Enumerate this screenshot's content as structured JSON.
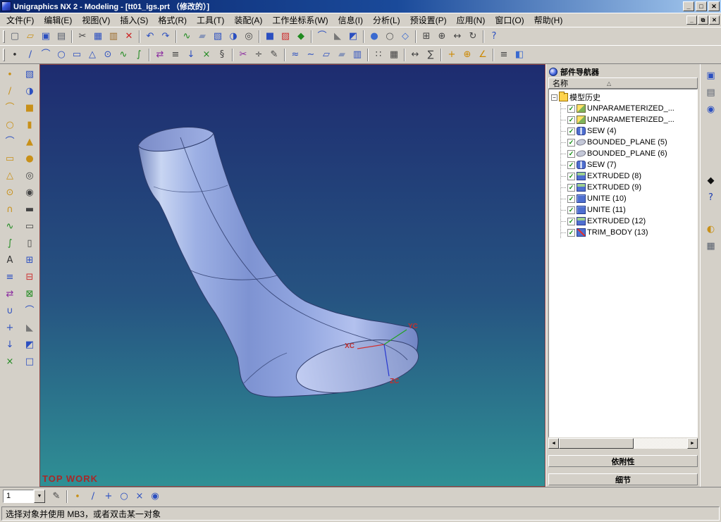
{
  "window": {
    "title": "Unigraphics NX 2 - Modeling - [tt01_igs.prt （修改的）]",
    "controls": {
      "minimize": "_",
      "maximize": "□",
      "close": "✕"
    }
  },
  "menu": {
    "items": [
      {
        "key": "file",
        "label": "文件(F)"
      },
      {
        "key": "edit",
        "label": "编辑(E)"
      },
      {
        "key": "view",
        "label": "视图(V)"
      },
      {
        "key": "insert",
        "label": "插入(S)"
      },
      {
        "key": "format",
        "label": "格式(R)"
      },
      {
        "key": "tools",
        "label": "工具(T)"
      },
      {
        "key": "assemblies",
        "label": "装配(A)"
      },
      {
        "key": "wcs",
        "label": "工作坐标系(W)"
      },
      {
        "key": "information",
        "label": "信息(I)"
      },
      {
        "key": "analysis",
        "label": "分析(L)"
      },
      {
        "key": "preferences",
        "label": "预设置(P)"
      },
      {
        "key": "application",
        "label": "应用(N)"
      },
      {
        "key": "window",
        "label": "窗口(O)"
      },
      {
        "key": "help",
        "label": "帮助(H)"
      }
    ],
    "child_controls": {
      "minimize": "_",
      "restore": "⧉",
      "close": "✕"
    }
  },
  "toolbar_main": {
    "items": [
      {
        "n": "new",
        "g": "▢",
        "c": "#58606e"
      },
      {
        "n": "open",
        "g": "▱",
        "c": "#c89018"
      },
      {
        "n": "save",
        "g": "▣",
        "c": "#2b4fc0"
      },
      {
        "n": "print",
        "g": "▤",
        "c": "#58606e"
      },
      {
        "sep": true
      },
      {
        "n": "cut",
        "g": "✂",
        "c": "#444444"
      },
      {
        "n": "copy",
        "g": "▦",
        "c": "#2b4fc0"
      },
      {
        "n": "paste",
        "g": "▥",
        "c": "#9a6a2a"
      },
      {
        "n": "delete",
        "g": "✕",
        "c": "#cc2020"
      },
      {
        "sep": true
      },
      {
        "n": "undo",
        "g": "↶",
        "c": "#2b4fc0"
      },
      {
        "n": "redo",
        "g": "↷",
        "c": "#2b4fc0"
      },
      {
        "sep": true
      },
      {
        "n": "sketch",
        "g": "∿",
        "c": "#1f8a1f"
      },
      {
        "n": "datum-plane",
        "g": "▰",
        "c": "#8a97b8"
      },
      {
        "n": "extrude",
        "g": "▧",
        "c": "#2b4fc0"
      },
      {
        "n": "revolve",
        "g": "◑",
        "c": "#2b4fc0"
      },
      {
        "n": "hole",
        "g": "◎",
        "c": "#444444"
      },
      {
        "sep": true
      },
      {
        "n": "unite",
        "g": "■",
        "c": "#2b4fc0"
      },
      {
        "n": "subtract",
        "g": "▨",
        "c": "#cc3030"
      },
      {
        "n": "intersect",
        "g": "◆",
        "c": "#1f8a1f"
      },
      {
        "sep": true
      },
      {
        "n": "edge-blend",
        "g": "⌒",
        "c": "#2b4fc0"
      },
      {
        "n": "chamfer",
        "g": "◣",
        "c": "#777777"
      },
      {
        "n": "trim-body",
        "g": "◩",
        "c": "#2b4fc0"
      },
      {
        "sep": true
      },
      {
        "n": "shaded-view",
        "g": "●",
        "c": "#3a6ad0"
      },
      {
        "n": "wireframe-view",
        "g": "○",
        "c": "#555555"
      },
      {
        "n": "isometric-view",
        "g": "◇",
        "c": "#3a6ad0"
      },
      {
        "sep": true
      },
      {
        "n": "fit-view",
        "g": "⊞",
        "c": "#444444"
      },
      {
        "n": "zoom-view",
        "g": "⊕",
        "c": "#444444"
      },
      {
        "n": "pan-view",
        "g": "↔",
        "c": "#444444"
      },
      {
        "n": "rotate-view",
        "g": "↻",
        "c": "#444444"
      },
      {
        "sep": true
      },
      {
        "n": "help",
        "g": "?",
        "c": "#2b4fc0"
      }
    ]
  },
  "toolbar_curve": {
    "items": [
      {
        "n": "point",
        "g": "∙",
        "c": "#333333"
      },
      {
        "n": "line",
        "g": "∕",
        "c": "#2b4fc0"
      },
      {
        "n": "arc",
        "g": "⌒",
        "c": "#2b4fc0"
      },
      {
        "n": "circle",
        "g": "○",
        "c": "#2b4fc0"
      },
      {
        "n": "rectangle",
        "g": "▭",
        "c": "#2b4fc0"
      },
      {
        "n": "polygon",
        "g": "△",
        "c": "#2b4fc0"
      },
      {
        "n": "ellipse",
        "g": "⊙",
        "c": "#2b4fc0"
      },
      {
        "n": "spline",
        "g": "∿",
        "c": "#1f8a1f"
      },
      {
        "n": "helix",
        "g": "∫",
        "c": "#1f8a1f"
      },
      {
        "sep": true
      },
      {
        "n": "mirror-curve",
        "g": "⇄",
        "c": "#8a2aa0"
      },
      {
        "n": "offset-curve",
        "g": "≡",
        "c": "#444444"
      },
      {
        "n": "project-curve",
        "g": "↓",
        "c": "#2b4fc0"
      },
      {
        "n": "intersection-curve",
        "g": "×",
        "c": "#1f8a1f"
      },
      {
        "n": "section-curve",
        "g": "§",
        "c": "#444444"
      },
      {
        "sep": true
      },
      {
        "n": "trim-curve",
        "g": "✂",
        "c": "#8a2aa0"
      },
      {
        "n": "divide-curve",
        "g": "÷",
        "c": "#444444"
      },
      {
        "n": "edit-curve",
        "g": "✎",
        "c": "#444444"
      },
      {
        "sep": true
      },
      {
        "n": "through-curves",
        "g": "≈",
        "c": "#2b4fc0"
      },
      {
        "n": "swept",
        "g": "∼",
        "c": "#2b4fc0"
      },
      {
        "n": "ruled-surface",
        "g": "▱",
        "c": "#2b4fc0"
      },
      {
        "n": "bounded-plane",
        "g": "▰",
        "c": "#8a97b8"
      },
      {
        "n": "sew-surface",
        "g": "▥",
        "c": "#2b4fc0"
      },
      {
        "sep": true
      },
      {
        "n": "instance-array",
        "g": "∷",
        "c": "#444444"
      },
      {
        "n": "pattern",
        "g": "▦",
        "c": "#444444"
      },
      {
        "sep": true
      },
      {
        "n": "measure-distance",
        "g": "↔",
        "c": "#444444"
      },
      {
        "n": "simple-analysis",
        "g": "∑",
        "c": "#444444"
      },
      {
        "sep": true
      },
      {
        "n": "wcs-dynamics",
        "g": "+",
        "c": "#cc8800"
      },
      {
        "n": "wcs-origin",
        "g": "⊕",
        "c": "#cc8800"
      },
      {
        "n": "wcs-rotate",
        "g": "∠",
        "c": "#cc8800"
      },
      {
        "sep": true
      },
      {
        "n": "layer-settings",
        "g": "≡",
        "c": "#444444"
      },
      {
        "n": "visualization",
        "g": "◧",
        "c": "#3a6ad0"
      }
    ]
  },
  "left_toolbar_1": {
    "items": [
      {
        "n": "curve-point",
        "g": "∙",
        "c": "#c89018"
      },
      {
        "n": "curve-line",
        "g": "∕",
        "c": "#c89018"
      },
      {
        "n": "curve-arc",
        "g": "⌒",
        "c": "#c89018"
      },
      {
        "n": "curve-circle",
        "g": "○",
        "c": "#c89018"
      },
      {
        "n": "curve-fillet",
        "g": "⌒",
        "c": "#2b4fc0"
      },
      {
        "n": "curve-rectangle",
        "g": "▭",
        "c": "#c89018"
      },
      {
        "n": "curve-polygon",
        "g": "△",
        "c": "#c89018"
      },
      {
        "n": "curve-ellipse",
        "g": "⊙",
        "c": "#c89018"
      },
      {
        "n": "curve-conic",
        "g": "∩",
        "c": "#c89018"
      },
      {
        "n": "curve-spline",
        "g": "∿",
        "c": "#1f8a1f"
      },
      {
        "n": "curve-helix",
        "g": "∫",
        "c": "#1f8a1f"
      },
      {
        "n": "curve-text",
        "g": "A",
        "c": "#333333"
      },
      {
        "n": "offset-curve-tool",
        "g": "≡",
        "c": "#2b4fc0"
      },
      {
        "n": "mirror-curve-tool",
        "g": "⇄",
        "c": "#8a2aa0"
      },
      {
        "n": "bridge-curve",
        "g": "∪",
        "c": "#2b4fc0"
      },
      {
        "n": "join-curve",
        "g": "+",
        "c": "#2b4fc0"
      },
      {
        "n": "project-curve-tool",
        "g": "↓",
        "c": "#2b4fc0"
      },
      {
        "n": "combine-curve",
        "g": "×",
        "c": "#1f8a1f"
      }
    ]
  },
  "left_toolbar_2": {
    "items": [
      {
        "n": "feature-extrude",
        "g": "▧",
        "c": "#2b4fc0"
      },
      {
        "n": "feature-revolve",
        "g": "◑",
        "c": "#2b4fc0"
      },
      {
        "n": "feature-block",
        "g": "■",
        "c": "#c89018"
      },
      {
        "n": "feature-cylinder",
        "g": "▮",
        "c": "#c89018"
      },
      {
        "n": "feature-cone",
        "g": "▲",
        "c": "#c89018"
      },
      {
        "n": "feature-sphere",
        "g": "●",
        "c": "#c89018"
      },
      {
        "n": "feature-hole",
        "g": "◎",
        "c": "#444444"
      },
      {
        "n": "feature-boss",
        "g": "◉",
        "c": "#444444"
      },
      {
        "n": "feature-pad",
        "g": "▬",
        "c": "#444444"
      },
      {
        "n": "feature-pocket",
        "g": "▭",
        "c": "#444444"
      },
      {
        "n": "feature-slot",
        "g": "▯",
        "c": "#444444"
      },
      {
        "n": "boolean-unite",
        "g": "⊞",
        "c": "#2b4fc0"
      },
      {
        "n": "boolean-subtract",
        "g": "⊟",
        "c": "#cc3030"
      },
      {
        "n": "boolean-intersect",
        "g": "⊠",
        "c": "#1f8a1f"
      },
      {
        "n": "feature-edge-blend",
        "g": "⌒",
        "c": "#2b4fc0"
      },
      {
        "n": "feature-chamfer",
        "g": "◣",
        "c": "#777777"
      },
      {
        "n": "feature-trim-body",
        "g": "◩",
        "c": "#2b4fc0"
      },
      {
        "n": "feature-shell",
        "g": "□",
        "c": "#2b4fc0"
      }
    ]
  },
  "viewport": {
    "view_label": "TOP WORK",
    "axis_labels": [
      "XC",
      "YC",
      "ZC"
    ]
  },
  "navigator": {
    "title": "部件导航器",
    "column_header": "名称",
    "sort_glyph": "△",
    "tree": {
      "root": {
        "label": "模型历史",
        "expander": "−",
        "icon": "folder"
      },
      "check_glyph": "✓",
      "items": [
        {
          "label": "UNPARAMETERIZED_...",
          "icon": "surface"
        },
        {
          "label": "UNPARAMETERIZED_...",
          "icon": "surface"
        },
        {
          "label": "SEW (4)",
          "icon": "sew"
        },
        {
          "label": "BOUNDED_PLANE (5)",
          "icon": "plane"
        },
        {
          "label": "BOUNDED_PLANE (6)",
          "icon": "plane"
        },
        {
          "label": "SEW (7)",
          "icon": "sew"
        },
        {
          "label": "EXTRUDED (8)",
          "icon": "extrude"
        },
        {
          "label": "EXTRUDED (9)",
          "icon": "extrude"
        },
        {
          "label": "UNITE (10)",
          "icon": "unite"
        },
        {
          "label": "UNITE (11)",
          "icon": "unite"
        },
        {
          "label": "EXTRUDED (12)",
          "icon": "extrude"
        },
        {
          "label": "TRIM_BODY (13)",
          "icon": "trim"
        }
      ]
    },
    "scrollbar": {
      "left_arrow": "◄",
      "right_arrow": "►"
    },
    "panels": [
      {
        "name": "dependencies",
        "label": "依附性"
      },
      {
        "name": "details",
        "label": "细节"
      }
    ]
  },
  "right_strip": {
    "items": [
      {
        "n": "assembly-navigator-tab",
        "g": "▣",
        "c": "#2b4fc0"
      },
      {
        "n": "constraint-navigator-tab",
        "g": "▤",
        "c": "#58606e"
      },
      {
        "n": "web-browser-tab",
        "g": "◉",
        "c": "#2b4fc0"
      },
      {
        "n": "roles-tab",
        "g": "◆",
        "c": "#111111",
        "gap": 78
      },
      {
        "n": "help-tab",
        "g": "?",
        "c": "#1a3ab0"
      },
      {
        "n": "history-palette-tab",
        "g": "◐",
        "c": "#c89018",
        "gap": 22
      },
      {
        "n": "palettes-tab",
        "g": "▦",
        "c": "#58606e"
      }
    ]
  },
  "bottom_toolbar": {
    "layer_combo": {
      "value": "1",
      "arrow": "▼"
    },
    "items": [
      {
        "n": "work-layer-edit",
        "g": "✎",
        "c": "#444444"
      },
      {
        "sep": true
      },
      {
        "n": "snap-point",
        "g": "∙",
        "c": "#c89018"
      },
      {
        "n": "snap-end-point",
        "g": "∕",
        "c": "#2b4fc0"
      },
      {
        "n": "snap-mid-point",
        "g": "+",
        "c": "#2b4fc0"
      },
      {
        "n": "snap-center",
        "g": "○",
        "c": "#2b4fc0"
      },
      {
        "n": "snap-intersection",
        "g": "×",
        "c": "#2b4fc0"
      },
      {
        "n": "snap-quadrant",
        "g": "◉",
        "c": "#2b4fc0"
      }
    ]
  },
  "status_bar": {
    "text": "选择对象并使用 MB3，或者双击某一对象"
  }
}
